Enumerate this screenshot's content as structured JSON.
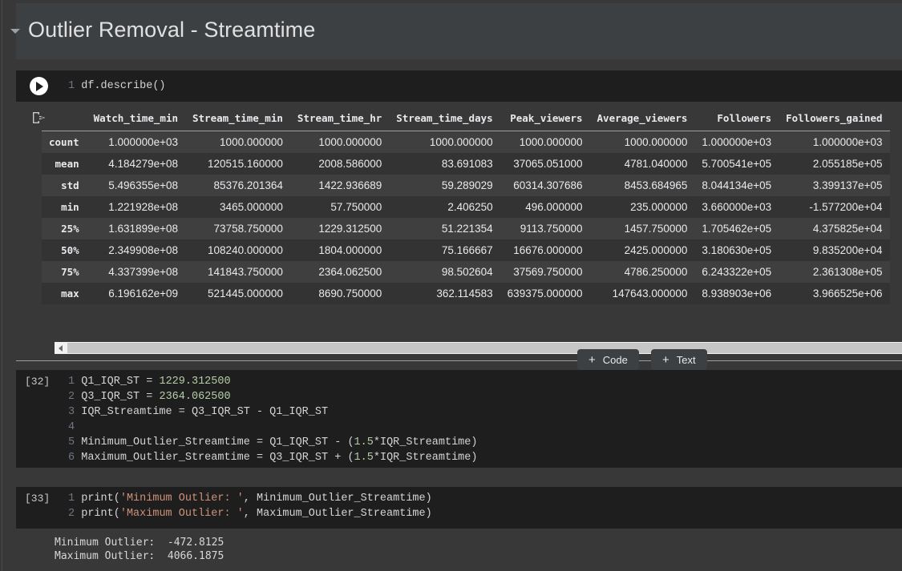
{
  "notebook": {
    "heading_cell": {
      "title": "Outlier Removal - Streamtime",
      "collapse_icon": "triangle-down-icon"
    },
    "cell_1": {
      "run_icon": "play-circle-icon",
      "line_number": "1",
      "code": "df.describe()",
      "output_icon": "output-export-icon"
    },
    "cell_2": {
      "exec_count": "[32]",
      "lines": [
        {
          "n": "1",
          "text": "Q1_IQR_ST = 1229.312500"
        },
        {
          "n": "2",
          "text": "Q3_IQR_ST = 2364.062500"
        },
        {
          "n": "3",
          "text": "IQR_Streamtime = Q3_IQR_ST - Q1_IQR_ST"
        },
        {
          "n": "4",
          "text": ""
        },
        {
          "n": "5",
          "text": "Minimum_Outlier_Streamtime = Q1_IQR_ST - (1.5*IQR_Streamtime)"
        },
        {
          "n": "6",
          "text": "Maximum_Outlier_Streamtime = Q3_IQR_ST + (1.5*IQR_Streamtime)"
        }
      ]
    },
    "cell_3": {
      "exec_count": "[33]",
      "lines": [
        {
          "n": "1",
          "text": "print('Minimum Outlier: ', Minimum_Outlier_Streamtime)"
        },
        {
          "n": "2",
          "text": "print('Maximum Outlier: ', Maximum_Outlier_Streamtime)"
        }
      ],
      "output": [
        "Minimum Outlier:  -472.8125",
        "Maximum Outlier:  4066.1875"
      ]
    }
  },
  "toolbar": {
    "add_code_label": "Code",
    "add_text_label": "Text",
    "plus_glyph": "+"
  },
  "scrollbar": {
    "left_arrow_icon": "chevron-left-icon"
  },
  "chart_data": {
    "type": "table",
    "title": "df.describe()",
    "index_label": "",
    "index": [
      "count",
      "mean",
      "std",
      "min",
      "25%",
      "50%",
      "75%",
      "max"
    ],
    "categories": [
      "Watch_time_min",
      "Stream_time_min",
      "Stream_time_hr",
      "Stream_time_days",
      "Peak_viewers",
      "Average_viewers",
      "Followers",
      "Followers_gained"
    ],
    "rows": [
      [
        "count",
        "1.000000e+03",
        "1000.000000",
        "1000.000000",
        "1000.000000",
        "1000.000000",
        "1000.000000",
        "1.000000e+03",
        "1.000000e+03"
      ],
      [
        "mean",
        "4.184279e+08",
        "120515.160000",
        "2008.586000",
        "83.691083",
        "37065.051000",
        "4781.040000",
        "5.700541e+05",
        "2.055185e+05"
      ],
      [
        "std",
        "5.496355e+08",
        "85376.201364",
        "1422.936689",
        "59.289029",
        "60314.307686",
        "8453.684965",
        "8.044134e+05",
        "3.399137e+05"
      ],
      [
        "min",
        "1.221928e+08",
        "3465.000000",
        "57.750000",
        "2.406250",
        "496.000000",
        "235.000000",
        "3.660000e+03",
        "-1.577200e+04"
      ],
      [
        "25%",
        "1.631899e+08",
        "73758.750000",
        "1229.312500",
        "51.221354",
        "9113.750000",
        "1457.750000",
        "1.705462e+05",
        "4.375825e+04"
      ],
      [
        "50%",
        "2.349908e+08",
        "108240.000000",
        "1804.000000",
        "75.166667",
        "16676.000000",
        "2425.000000",
        "3.180630e+05",
        "9.835200e+04"
      ],
      [
        "75%",
        "4.337399e+08",
        "141843.750000",
        "2364.062500",
        "98.502604",
        "37569.750000",
        "4786.250000",
        "6.243322e+05",
        "2.361308e+05"
      ],
      [
        "max",
        "6.196162e+09",
        "521445.000000",
        "8690.750000",
        "362.114583",
        "639375.000000",
        "147643.000000",
        "8.938903e+06",
        "3.966525e+06"
      ]
    ]
  },
  "colors": {
    "page_bg": "#383838",
    "cell_bg": "#1e1e1e",
    "md_cell_bg": "#3c4043",
    "row_odd": "#3f3f3f",
    "row_even": "#333333",
    "text": "#e8eaed",
    "number_token": "#b5cea8",
    "string_token": "#ce9178",
    "scrollbar_track": "#f1f1f1",
    "scrollbar_thumb": "#c6c6c6"
  }
}
